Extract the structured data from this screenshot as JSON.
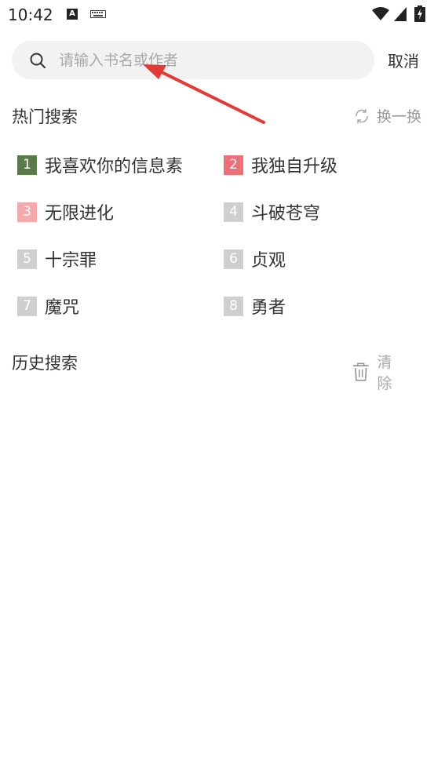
{
  "status_bar": {
    "time": "10:42",
    "a_badge": "A"
  },
  "search": {
    "placeholder": "请输入书名或作者",
    "value": "",
    "cancel_label": "取消"
  },
  "hot_search": {
    "title": "热门搜索",
    "refresh_label": "换一换",
    "items": [
      {
        "rank": "1",
        "label": "我喜欢你的信息素"
      },
      {
        "rank": "2",
        "label": "我独自升级"
      },
      {
        "rank": "3",
        "label": "无限进化"
      },
      {
        "rank": "4",
        "label": "斗破苍穹"
      },
      {
        "rank": "5",
        "label": "十宗罪"
      },
      {
        "rank": "6",
        "label": "贞观"
      },
      {
        "rank": "7",
        "label": "魔咒"
      },
      {
        "rank": "8",
        "label": "勇者"
      }
    ]
  },
  "history_search": {
    "title": "历史搜索",
    "clear_label": "清除"
  },
  "colors": {
    "rank1": "#5a7a4a",
    "rank2": "#ee6f77",
    "rank3": "#f4a9ad",
    "rank_other": "#cfcfcf",
    "search_bg": "#f2f2f2",
    "annotation_arrow": "#e53935"
  }
}
